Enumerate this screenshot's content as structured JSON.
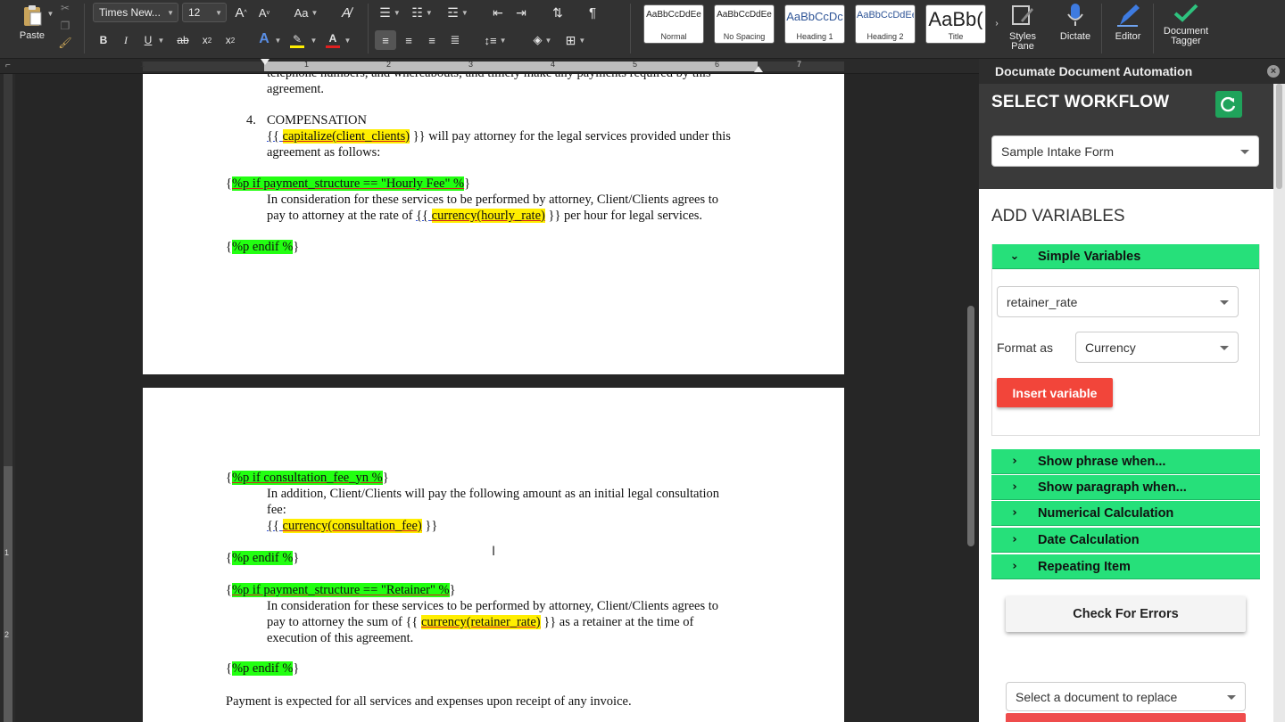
{
  "ribbon": {
    "paste_label": "Paste",
    "font_name": "Times New...",
    "font_size": "12",
    "grow_label": "A",
    "shrink_label": "A",
    "case_label": "Aa",
    "bold": "B",
    "italic": "I",
    "underline": "U",
    "strike": "ab",
    "subscript": "x",
    "superscript": "x",
    "pilcrow": "¶",
    "styles": [
      {
        "sample": "AaBbCcDdEe",
        "name": "Normal"
      },
      {
        "sample": "AaBbCcDdEe",
        "name": "No Spacing"
      },
      {
        "sample": "AaBbCcDc",
        "name": "Heading 1"
      },
      {
        "sample": "AaBbCcDdEe",
        "name": "Heading 2"
      },
      {
        "sample": "AaBb(",
        "name": "Title"
      }
    ],
    "styles_pane_line1": "Styles",
    "styles_pane_line2": "Pane",
    "dictate_label": "Dictate",
    "editor_label": "Editor",
    "tagger_line1": "Document",
    "tagger_line2": "Tagger"
  },
  "ruler": {
    "numbers": [
      "1",
      "1",
      "2",
      "3",
      "4",
      "5",
      "6",
      "7"
    ]
  },
  "vruler": {
    "numbers": [
      "1",
      "2"
    ]
  },
  "document": {
    "p1_line1": "telephone numbers, and whereabouts; and timely make any payments required by this",
    "p1_line2": "agreement.",
    "item_number": "4.",
    "item_title": "COMPENSATION",
    "comp_open": "{{ ",
    "comp_var": "capitalize(client_clients)",
    "comp_close": " }}",
    "comp_rest": " will pay attorney for the legal services provided under this",
    "comp_line2": "agreement as follows:",
    "if_hourly_brace": "{",
    "if_hourly_tag": "%p if payment_structure == \"Hourly Fee\" %",
    "if_hourly_end": "}",
    "hourly_line1": "In consideration for these services to be performed by attorney, Client/Clients agrees to",
    "hourly_line2_pre": "pay to attorney at the rate of ",
    "hourly_open": "{{ ",
    "hourly_var": "currency(hourly_rate)",
    "hourly_close": " }}",
    "hourly_line2_post": " per hour for legal services.",
    "endif_brace": "{",
    "endif_tag": "%p endif %",
    "endif_end": "}",
    "if_consult_tag": "%p if consultation_fee_yn %",
    "consult_line1": "In addition, Client/Clients will pay the following amount as an initial legal consultation",
    "consult_line2": "fee:",
    "consult_open": "{{ ",
    "consult_var": "currency(consultation_fee)",
    "consult_close": " }}",
    "if_retainer_tag": "%p if payment_structure == \"Retainer\" %",
    "retainer_line1": "In consideration for these services to be performed by attorney, Client/Clients agrees to",
    "retainer_line2_pre": "pay to attorney the sum of ",
    "retainer_open": "{{ ",
    "retainer_var": "currency(retainer_rate)",
    "retainer_close": " }}",
    "retainer_line2_post": " as a retainer at the time of",
    "retainer_line3": "execution of this agreement.",
    "payment_line": "Payment is expected for all services and expenses upon receipt of any invoice.",
    "cursor_glyph": "I"
  },
  "panel": {
    "title": "Documate Document Automation",
    "close_glyph": "×",
    "workflow_heading": "SELECT WORKFLOW",
    "workflow_selected": "Sample Intake Form",
    "add_variables_heading": "ADD VARIABLES",
    "simple_variables_label": "Simple Variables",
    "variable_selected": "retainer_rate",
    "format_as_label": "Format as",
    "format_selected": "Currency",
    "insert_button": "Insert variable",
    "sections": [
      "Show phrase when...",
      "Show paragraph when...",
      "Numerical Calculation",
      "Date Calculation",
      "Repeating Item"
    ],
    "check_errors_button": "Check For Errors",
    "replace_placeholder": "Select a document to replace"
  },
  "colors": {
    "accent_green": "#26e07a",
    "insert_red": "#f2453a",
    "highlight_yellow": "#ffee00",
    "highlight_green": "#22ff11"
  }
}
